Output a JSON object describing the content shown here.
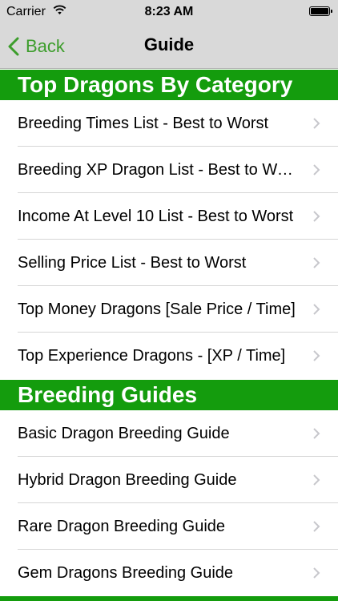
{
  "status_bar": {
    "carrier": "Carrier",
    "time": "8:23 AM"
  },
  "nav": {
    "back_label": "Back",
    "title": "Guide"
  },
  "sections": [
    {
      "title": "Top Dragons By Category",
      "items": [
        "Breeding Times List - Best to Worst",
        "Breeding XP Dragon List - Best to Worst",
        "Income At Level 10 List - Best to Worst",
        "Selling Price List - Best to Worst",
        "Top Money Dragons [Sale Price / Time]",
        "Top Experience Dragons - [XP / Time]"
      ]
    },
    {
      "title": "Breeding Guides",
      "items": [
        "Basic Dragon Breeding Guide",
        "Hybrid Dragon Breeding Guide",
        "Rare Dragon Breeding Guide",
        "Gem Dragons Breeding Guide"
      ]
    }
  ],
  "colors": {
    "accent": "#149c0d",
    "back_tint": "#3c9d2b",
    "bar_bg": "#d9d9d9"
  },
  "icons": [
    "wifi-icon",
    "battery-icon",
    "chevron-left-icon",
    "chevron-right-icon"
  ]
}
